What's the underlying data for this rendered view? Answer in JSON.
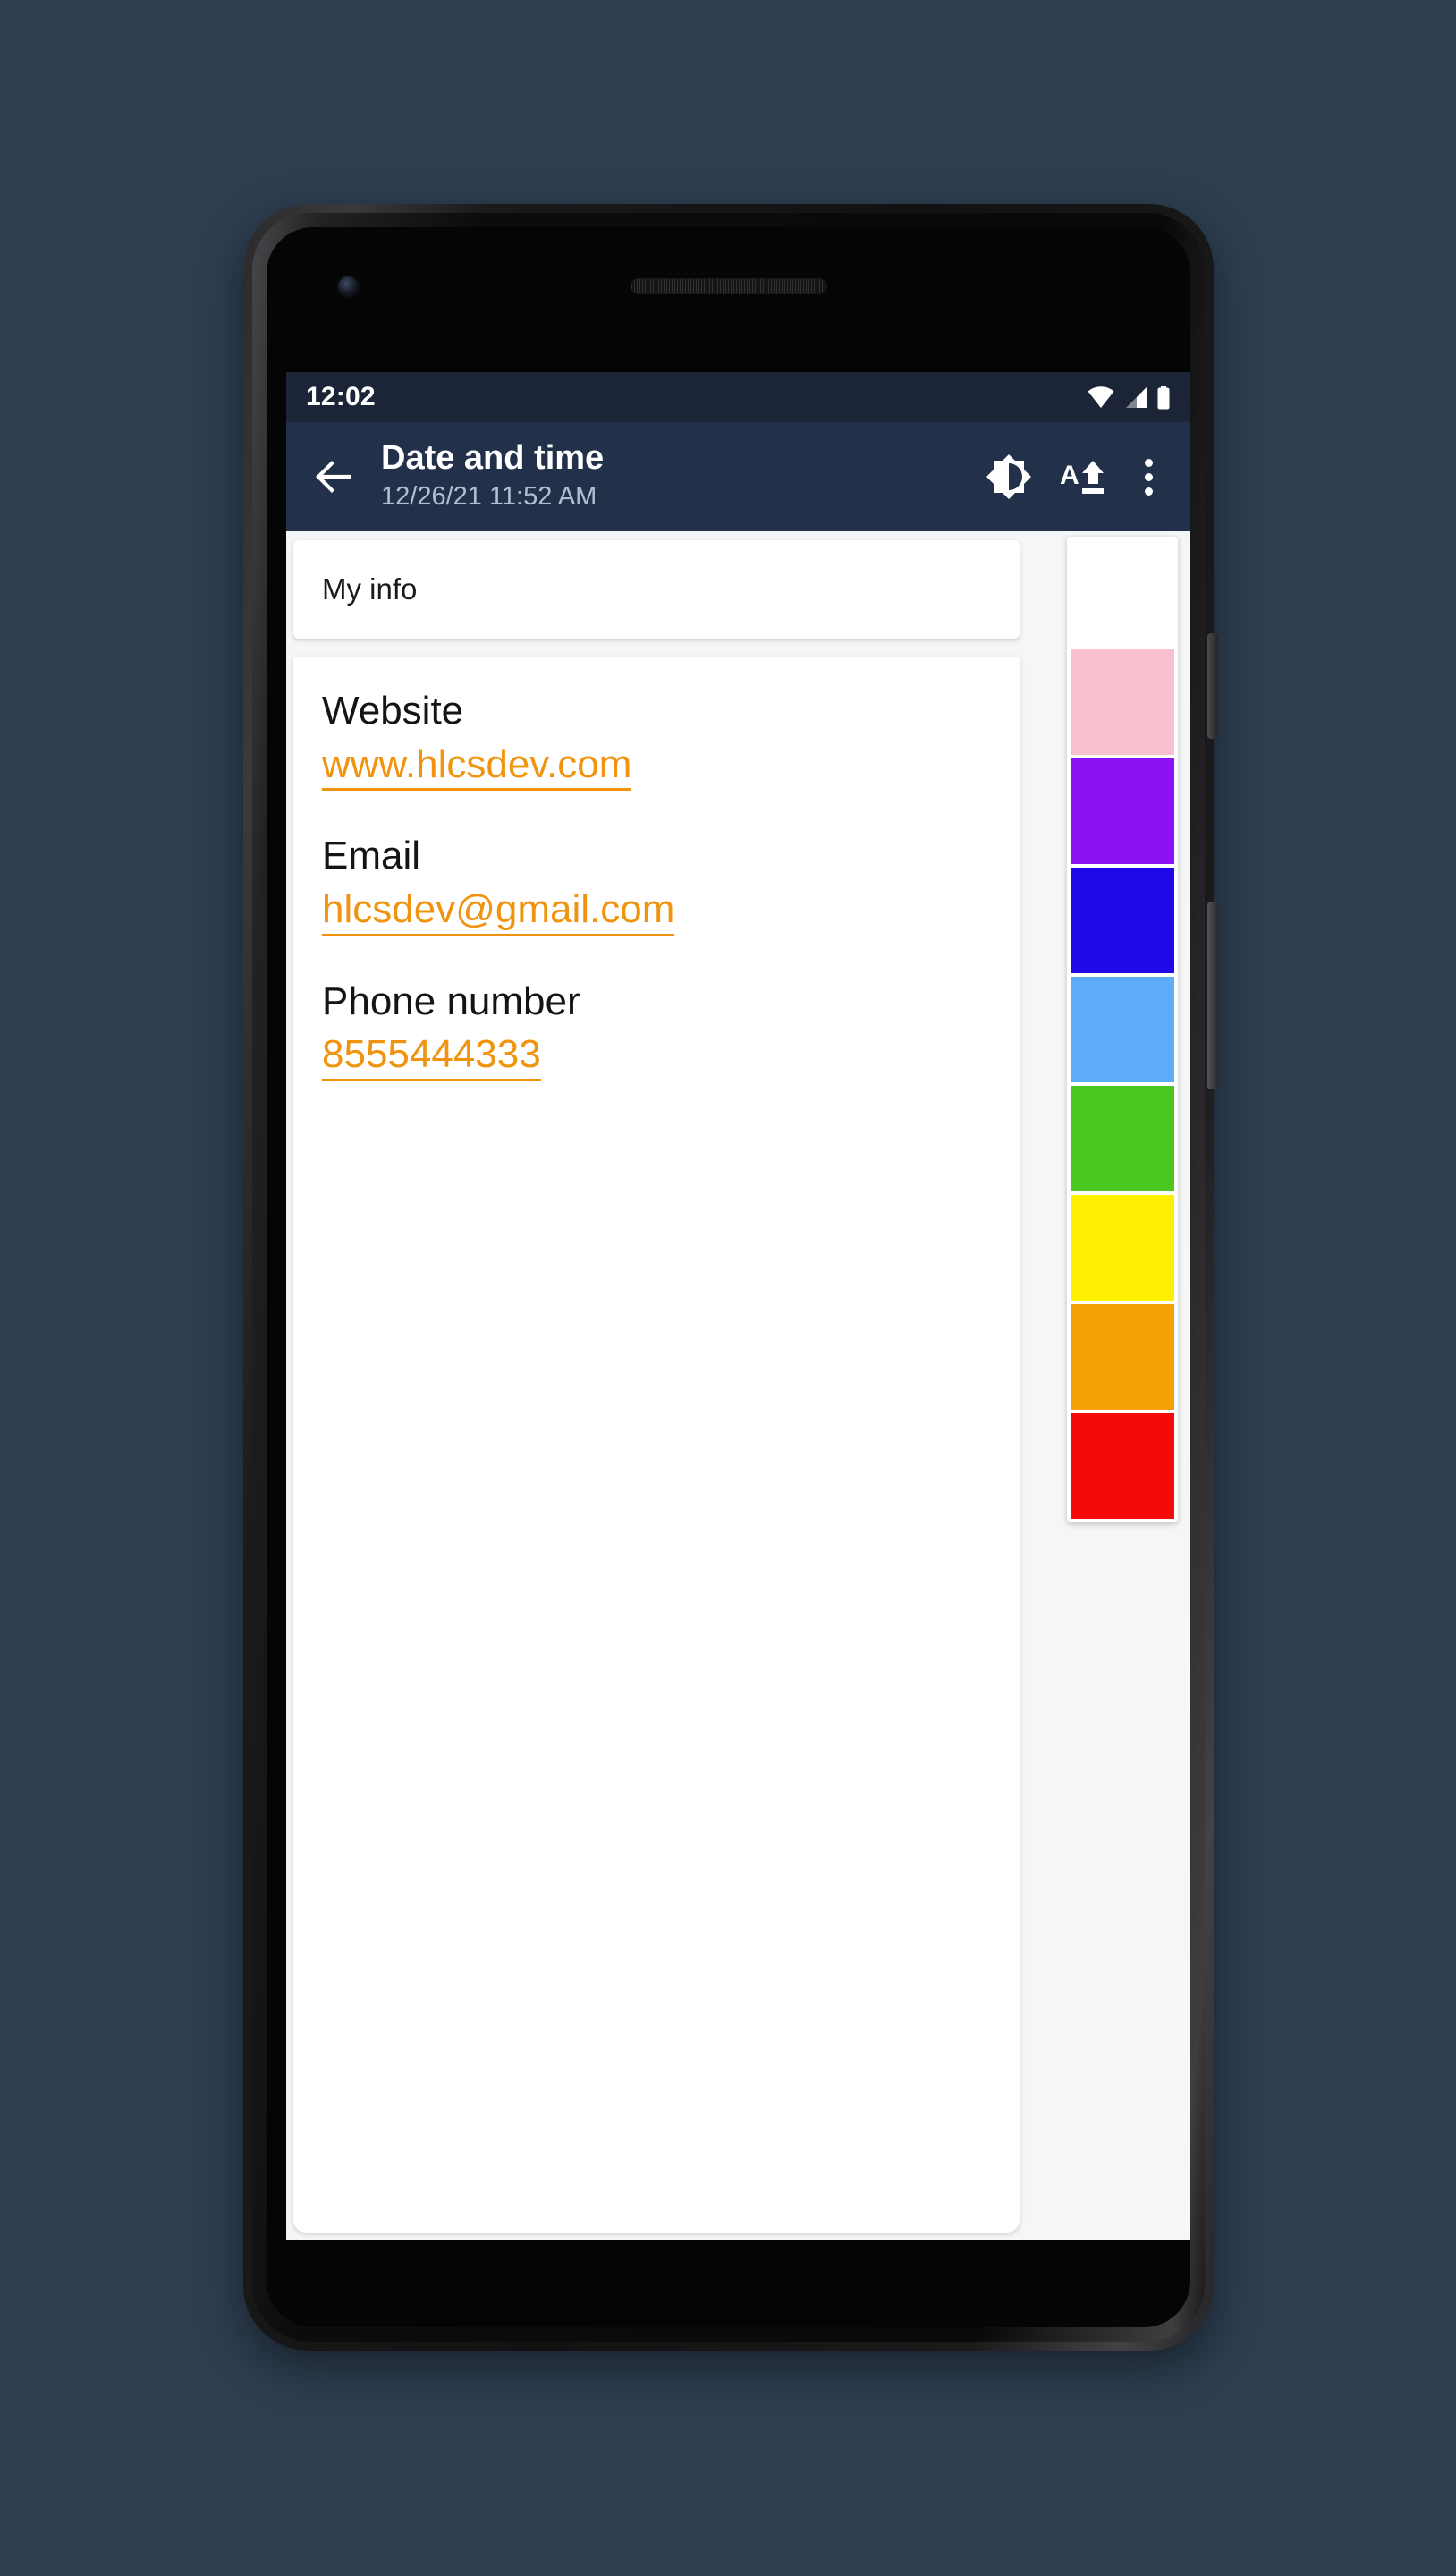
{
  "device": {
    "type": "android-phone-mockup",
    "bezel_color": "#121213",
    "page_background": "#2d3e50"
  },
  "status_bar": {
    "time": "12:02",
    "background": "#1c2538",
    "icons": [
      "wifi-icon",
      "cellular-signal-icon",
      "battery-icon"
    ]
  },
  "app_bar": {
    "background": "#22304a",
    "back_icon": "arrow-left-icon",
    "title": "Date and time",
    "subtitle": "12/26/21   11:52 AM",
    "actions": [
      {
        "name": "brightness-contrast-icon",
        "label": "Brightness"
      },
      {
        "name": "text-size-increase-icon",
        "label": "A"
      },
      {
        "name": "overflow-menu-icon",
        "label": "More options"
      }
    ]
  },
  "content": {
    "background": "#f5f6f7",
    "my_info_card": {
      "label": "My info"
    },
    "note_card": {
      "fields": [
        {
          "label": "Website",
          "value": "www.hlcsdev.com",
          "kind": "url"
        },
        {
          "label": "Email",
          "value": "hlcsdev@gmail.com",
          "kind": "email"
        },
        {
          "label": "Phone number",
          "value": "8555444333",
          "kind": "tel"
        }
      ],
      "link_color": "#f0940f",
      "label_color": "#141414"
    }
  },
  "color_palette": {
    "swatches": [
      {
        "name": "white",
        "hex": "#ffffff"
      },
      {
        "name": "pink",
        "hex": "#f9c0cf"
      },
      {
        "name": "purple",
        "hex": "#8b12f5"
      },
      {
        "name": "blue",
        "hex": "#2009e8"
      },
      {
        "name": "light-blue",
        "hex": "#5cacfa"
      },
      {
        "name": "green",
        "hex": "#4bc722"
      },
      {
        "name": "yellow",
        "hex": "#fdf001"
      },
      {
        "name": "orange",
        "hex": "#f5a208"
      },
      {
        "name": "red",
        "hex": "#f40a06"
      }
    ]
  }
}
